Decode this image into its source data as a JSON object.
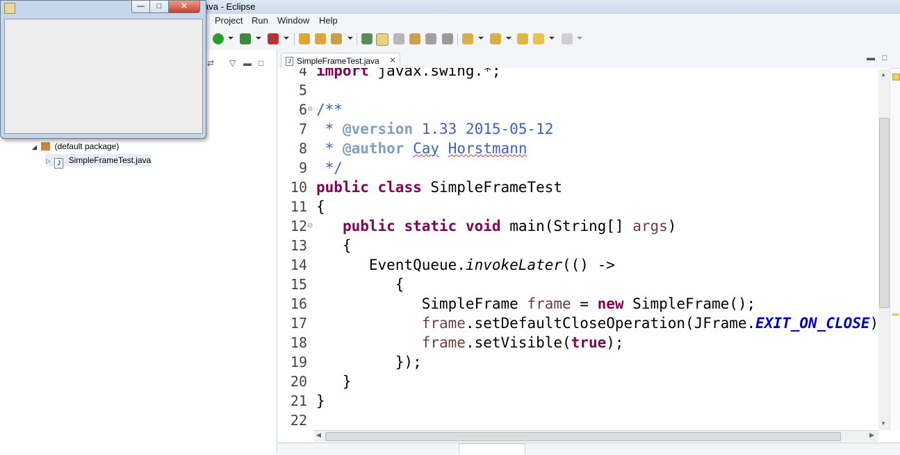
{
  "window": {
    "title": "ava - Eclipse"
  },
  "menu": [
    "Project",
    "Run",
    "Window",
    "Help"
  ],
  "package_explorer": {
    "package_label": "(default package)",
    "file_label": "SimpleFrameTest.java"
  },
  "swing_frame": {
    "minimize": "—",
    "maximize": "□",
    "close": "✕"
  },
  "editor": {
    "tab_label": "SimpleFrameTest.java",
    "tab_close": "✕",
    "lines": [
      {
        "n": "4",
        "parts": [
          [
            "kw",
            "import"
          ],
          [
            "",
            " javax.swing.*;"
          ]
        ]
      },
      {
        "n": "5",
        "parts": []
      },
      {
        "n": "6",
        "fold": true,
        "parts": [
          [
            "doc",
            "/**"
          ]
        ]
      },
      {
        "n": "7",
        "parts": [
          [
            "doc",
            " * "
          ],
          [
            "tag",
            "@version"
          ],
          [
            "doc",
            " 1.33 2015-05-12"
          ]
        ]
      },
      {
        "n": "8",
        "parts": [
          [
            "doc",
            " * "
          ],
          [
            "tag",
            "@author"
          ],
          [
            "doc",
            " "
          ],
          [
            "doc squig",
            "Cay"
          ],
          [
            "doc",
            " "
          ],
          [
            "doc squig",
            "Horstmann"
          ]
        ]
      },
      {
        "n": "9",
        "parts": [
          [
            "doc",
            " */"
          ]
        ]
      },
      {
        "n": "10",
        "parts": [
          [
            "kw",
            "public"
          ],
          [
            "",
            " "
          ],
          [
            "kw",
            "class"
          ],
          [
            "",
            " SimpleFrameTest"
          ]
        ]
      },
      {
        "n": "11",
        "parts": [
          [
            "",
            "{"
          ]
        ]
      },
      {
        "n": "12",
        "fold": true,
        "parts": [
          [
            "",
            "   "
          ],
          [
            "kw",
            "public"
          ],
          [
            "",
            " "
          ],
          [
            "kw",
            "static"
          ],
          [
            "",
            " "
          ],
          [
            "kw",
            "void"
          ],
          [
            "",
            " main(String[] "
          ],
          [
            "var",
            "args"
          ],
          [
            "",
            ")"
          ]
        ]
      },
      {
        "n": "13",
        "parts": [
          [
            "",
            "   {"
          ]
        ]
      },
      {
        "n": "14",
        "parts": [
          [
            "",
            "      EventQueue."
          ],
          [
            "static",
            "invokeLater"
          ],
          [
            "",
            "(() ->"
          ]
        ]
      },
      {
        "n": "15",
        "parts": [
          [
            "",
            "         {"
          ]
        ]
      },
      {
        "n": "16",
        "parts": [
          [
            "",
            "            SimpleFrame "
          ],
          [
            "var",
            "frame"
          ],
          [
            "",
            " = "
          ],
          [
            "kw",
            "new"
          ],
          [
            "",
            " SimpleFrame();"
          ]
        ]
      },
      {
        "n": "17",
        "parts": [
          [
            "",
            "            "
          ],
          [
            "var",
            "frame"
          ],
          [
            "",
            ".setDefaultCloseOperation(JFrame."
          ],
          [
            "const",
            "EXIT_ON_CLOSE"
          ],
          [
            "",
            ");"
          ]
        ]
      },
      {
        "n": "18",
        "parts": [
          [
            "",
            "            "
          ],
          [
            "var",
            "frame"
          ],
          [
            "",
            ".setVisible("
          ],
          [
            "kw",
            "true"
          ],
          [
            "",
            ");"
          ]
        ]
      },
      {
        "n": "19",
        "parts": [
          [
            "",
            "         });"
          ]
        ]
      },
      {
        "n": "20",
        "parts": [
          [
            "",
            "   }"
          ]
        ]
      },
      {
        "n": "21",
        "parts": [
          [
            "",
            "}"
          ]
        ]
      },
      {
        "n": "22",
        "parts": []
      }
    ]
  },
  "colors": {
    "keyword": "#7f0055",
    "javadoc": "#3f5fbf",
    "javadoc_tag": "#7f9fbf",
    "local_var": "#6a3e3e",
    "constant": "#0000c0"
  }
}
